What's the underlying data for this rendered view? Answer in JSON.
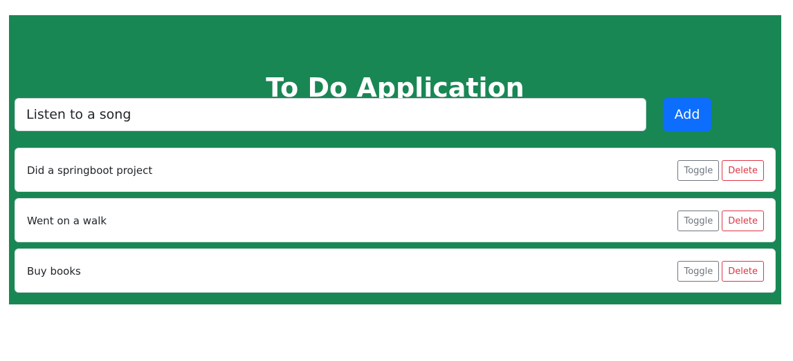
{
  "app": {
    "title": "To Do Application"
  },
  "new_todo": {
    "value": "Listen to a song",
    "add_label": "Add"
  },
  "todos": [
    {
      "text": "Did a springboot project",
      "toggle_label": "Toggle",
      "delete_label": "Delete"
    },
    {
      "text": "Went on a walk",
      "toggle_label": "Toggle",
      "delete_label": "Delete"
    },
    {
      "text": "Buy books",
      "toggle_label": "Toggle",
      "delete_label": "Delete"
    }
  ],
  "colors": {
    "panel_bg": "#198754",
    "primary": "#0d6efd",
    "secondary": "#6c757d",
    "danger": "#dc3545"
  }
}
